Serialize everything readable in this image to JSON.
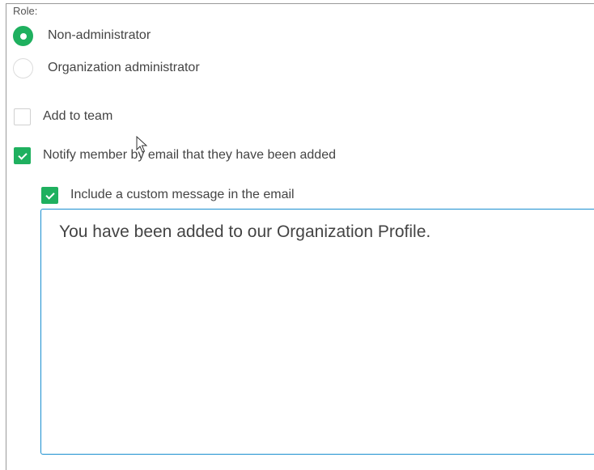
{
  "role": {
    "label": "Role:",
    "options": [
      {
        "label": "Non-administrator",
        "selected": true
      },
      {
        "label": "Organization administrator",
        "selected": false
      }
    ]
  },
  "add_to_team": {
    "label": "Add to team",
    "checked": false
  },
  "notify": {
    "label": "Notify member by email that they have been added",
    "checked": true
  },
  "custom_message": {
    "label": "Include a custom message in the email",
    "checked": true,
    "value": "You have been added to our Organization Profile."
  },
  "colors": {
    "accent": "#1fb05f",
    "focus_border": "#1a8fd0"
  }
}
